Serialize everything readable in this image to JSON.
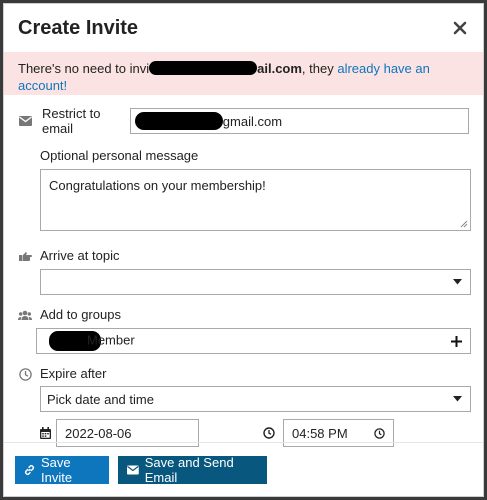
{
  "modal": {
    "title": "Create Invite",
    "close_icon": "close-icon"
  },
  "alert": {
    "text_before": "There's no need to invi",
    "text_domain": "ail.com",
    "text_middle": ", they ",
    "link_text": "already have an account!"
  },
  "restrict": {
    "label": "Restrict to email",
    "value_suffix": "gmail.com"
  },
  "message": {
    "label": "Optional personal message",
    "value": "Congratulations on your membership!"
  },
  "topic": {
    "label": "Arrive at topic",
    "value": ""
  },
  "groups": {
    "label": "Add to groups",
    "value_suffix": "Member"
  },
  "expire": {
    "label": "Expire after",
    "value": "Pick date and time",
    "date": "2022-08-06",
    "time": "04:58 PM"
  },
  "footer": {
    "save_label": "Save Invite",
    "save_send_label": "Save and Send Email"
  },
  "colors": {
    "primary": "#0e76bd",
    "dark": "#08577e",
    "alert_bg": "#fbe3e3"
  }
}
